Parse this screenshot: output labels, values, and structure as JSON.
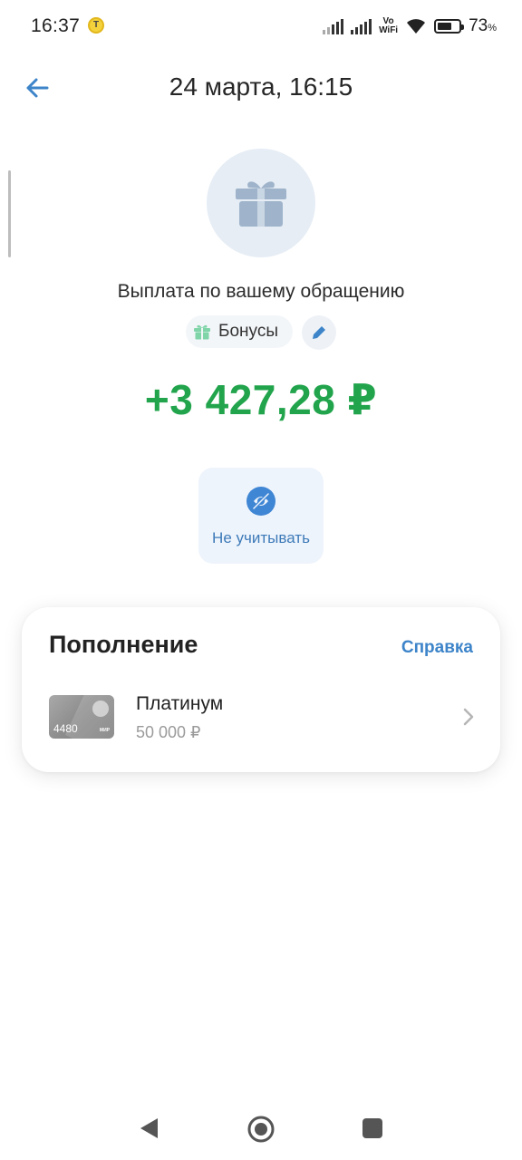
{
  "status_bar": {
    "time": "16:37",
    "badge": "T",
    "network_label_top": "Vo",
    "network_label_bottom": "WiFi",
    "battery_percent": "73",
    "battery_unit": "%"
  },
  "header": {
    "title": "24 марта, 16:15"
  },
  "operation": {
    "description": "Выплата по вашему обращению",
    "category": "Бонусы",
    "amount": "+3 427,28 ₽",
    "amount_color": "#21a44c"
  },
  "actions": {
    "ignore_label": "Не учитывать"
  },
  "topup": {
    "title": "Пополнение",
    "help_link": "Справка",
    "account": {
      "name": "Платинум",
      "balance": "50 000 ₽",
      "card_last_digits": "4480",
      "card_brand": "МИР"
    }
  },
  "colors": {
    "accent": "#3d84c9",
    "positive": "#21a44c"
  }
}
